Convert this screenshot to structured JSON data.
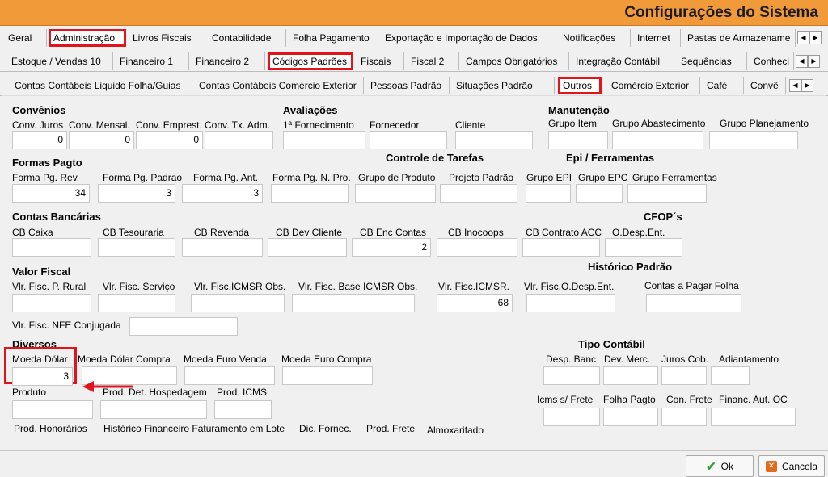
{
  "window": {
    "title": "Configurações do Sistema"
  },
  "tabs": {
    "row1": [
      "Geral",
      "Administração",
      "Livros Fiscais",
      "Contabilidade",
      "Folha Pagamento",
      "Exportação e Importação de Dados",
      "Notificações",
      "Internet",
      "Pastas de Armazename"
    ],
    "row2": [
      "Estoque / Vendas 10",
      "Financeiro 1",
      "Financeiro 2",
      "Códigos Padrões",
      "Fiscais",
      "Fiscal 2",
      "Campos Obrigatórios",
      "Integração Contábil",
      "Sequências",
      "Conheci"
    ],
    "row3": [
      "Contas Contábeis Liquido Folha/Guias",
      "Contas Contábeis Comércio Exterior",
      "Pessoas Padrão",
      "Situações Padrão",
      "Outros",
      "Comércio Exterior",
      "Café",
      "Convê"
    ]
  },
  "sections": {
    "convenios": {
      "title": "Convênios",
      "labels": [
        "Conv. Juros",
        "Conv. Mensal.",
        "Conv. Emprest.",
        "Conv. Tx. Adm."
      ],
      "values": [
        "0",
        "0",
        "0",
        ""
      ]
    },
    "avaliacoes": {
      "title": "Avaliações",
      "labels": [
        "1ª Fornecimento",
        "Fornecedor",
        "Cliente"
      ]
    },
    "manutencao": {
      "title": "Manutenção",
      "labels": [
        "Grupo Item",
        "Grupo Abastecimento",
        "Grupo Planejamento"
      ]
    },
    "formas_pagto": {
      "title": "Formas Pagto",
      "labels": [
        "Forma Pg. Rev.",
        "Forma Pg. Padrao",
        "Forma Pg. Ant.",
        "Forma Pg. N. Pro."
      ],
      "values": [
        "34",
        "3",
        "3",
        ""
      ]
    },
    "controle_tarefas": {
      "title": "Controle de Tarefas",
      "labels": [
        "Grupo de Produto",
        "Projeto Padrão"
      ]
    },
    "epi": {
      "title": "Epi / Ferramentas",
      "labels": [
        "Grupo EPI",
        "Grupo EPC",
        "Grupo Ferramentas"
      ]
    },
    "contas_bancarias": {
      "title": "Contas Bancárias",
      "labels": [
        "CB Caixa",
        "CB Tesouraria",
        "CB Revenda",
        "CB Dev Cliente",
        "CB Enc Contas",
        "CB Inocoops",
        "CB Contrato ACC"
      ],
      "values": [
        "",
        "",
        "",
        "",
        "2",
        "",
        ""
      ]
    },
    "cfop": {
      "title": "CFOP´s",
      "labels": [
        "O.Desp.Ent."
      ]
    },
    "valor_fiscal": {
      "title": "Valor Fiscal",
      "labels": [
        "Vlr. Fisc. P. Rural",
        "Vlr. Fisc. Serviço",
        "Vlr. Fisc.ICMSR Obs.",
        "Vlr. Fisc. Base ICMSR Obs.",
        "Vlr. Fisc.ICMSR.",
        "Vlr. Fisc.O.Desp.Ent."
      ],
      "values": [
        "",
        "",
        "",
        "",
        "68",
        ""
      ],
      "nfe_label": "Vlr. Fisc. NFE Conjugada"
    },
    "historico_padrao": {
      "title": "Histórico Padrão",
      "labels": [
        "Contas a Pagar Folha"
      ]
    },
    "diversos": {
      "title": "Diversos",
      "labels": [
        "Moeda Dólar",
        "Moeda Dólar Compra",
        "Moeda Euro Venda",
        "Moeda Euro Compra"
      ],
      "values": [
        "3",
        "",
        "",
        ""
      ],
      "row2_labels": [
        "Produto",
        "Prod. Det. Hospedagem",
        "Prod. ICMS"
      ],
      "row3_labels": [
        "Prod. Honorários",
        "Histórico Financeiro Faturamento em Lote",
        "Dic. Fornec.",
        "Prod. Frete",
        "Almoxarifado"
      ]
    },
    "tipo_contabil": {
      "title": "Tipo Contábil",
      "labels": [
        "Desp. Banc",
        "Dev. Merc.",
        "Juros Cob.",
        "Adiantamento"
      ],
      "labels2": [
        "Icms s/ Frete",
        "Folha Pagto",
        "Con. Frete",
        "Financ. Aut. OC"
      ]
    }
  },
  "buttons": {
    "ok": {
      "label": "Ok",
      "icon": "check-icon",
      "color": "#2e9e2e"
    },
    "cancel": {
      "label": "Cancela",
      "icon": "cancel-icon",
      "color": "#e36b1c"
    }
  },
  "colors": {
    "titlebar": "#f09a3a",
    "highlight": "#e0141a"
  }
}
